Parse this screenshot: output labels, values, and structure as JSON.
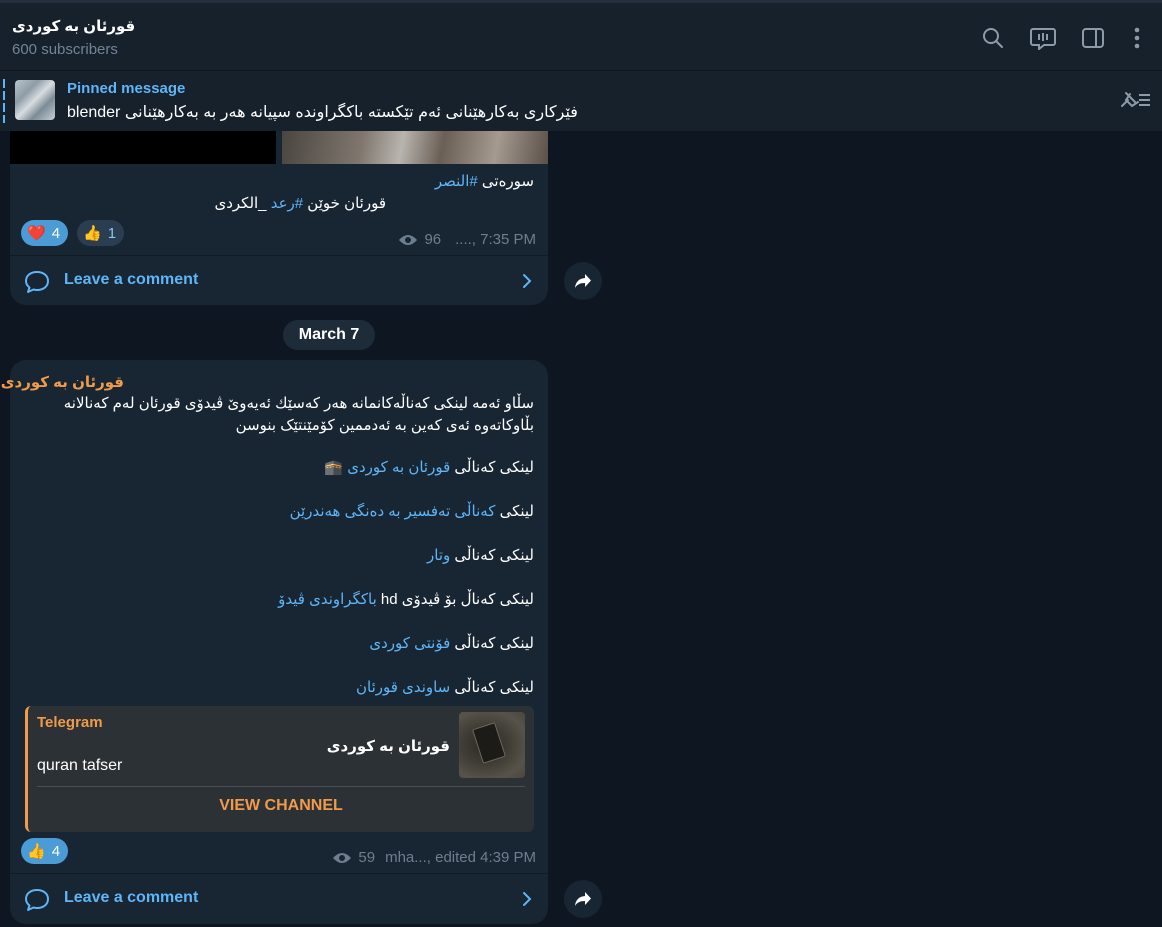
{
  "header": {
    "title": "قورئان بە کوردی",
    "subscribers": "600 subscribers"
  },
  "pinned": {
    "label": "Pinned message",
    "text": "blender فێرکاری بەکارهێنانی ئەم تێکستە  باکگراوندە سپیانە هەر بە بەکارهێنانی"
  },
  "message1": {
    "line1_prefix": "سورەتی ",
    "line1_link": "#النصر",
    "line2_prefix": "قورئان خوێن ",
    "line2_link": "#رعد",
    "line2_suffix": " _الكردی",
    "reactions": [
      {
        "emoji": "❤️",
        "count": "4"
      },
      {
        "emoji": "👍",
        "count": "1"
      }
    ],
    "views": "96",
    "time": "...., 7:35 PM",
    "comment_label": "Leave a comment"
  },
  "date_separator": "March 7",
  "message2": {
    "author": "قورئان بە کوردی",
    "intro1": "سڵاو ئەمە لینکی کەناڵەکانمانە هەر کەسێك ئەیەوێ ڤیدۆی قورئان لەم کەنالانە",
    "intro2": "بڵاوکاتەوە ئەی کەین بە ئەدممین کۆمێنتێک بنوسن",
    "links": [
      {
        "prefix": "لینکی کەناڵی ",
        "link": "قورئان بە کوردی",
        "suffix": " 🕋"
      },
      {
        "prefix": "لینکی ",
        "link": "کەناڵی تەفسیر بە دەنگی هەندرێن",
        "suffix": ""
      },
      {
        "prefix": "لینکی کەناڵی ",
        "link": "وتار",
        "suffix": ""
      },
      {
        "prefix": "لینکی کەناڵ بۆ ڤیدۆی hd ",
        "link": "باکگراوندی ڤیدۆ",
        "suffix": ""
      },
      {
        "prefix": "لینکی کەناڵی  ",
        "link": "فۆنتی کوردی",
        "suffix": ""
      },
      {
        "prefix": "لینکی کەناڵی ",
        "link": "ساوندی قورئان",
        "suffix": ""
      }
    ],
    "preview": {
      "site": "Telegram",
      "title": "قورئان بە کوردی",
      "description": "quran tafser",
      "button": "VIEW CHANNEL"
    },
    "reactions": [
      {
        "emoji": "👍",
        "count": "4"
      }
    ],
    "views": "59",
    "time": "mha..., edited 4:39 PM",
    "comment_label": "Leave a comment"
  }
}
